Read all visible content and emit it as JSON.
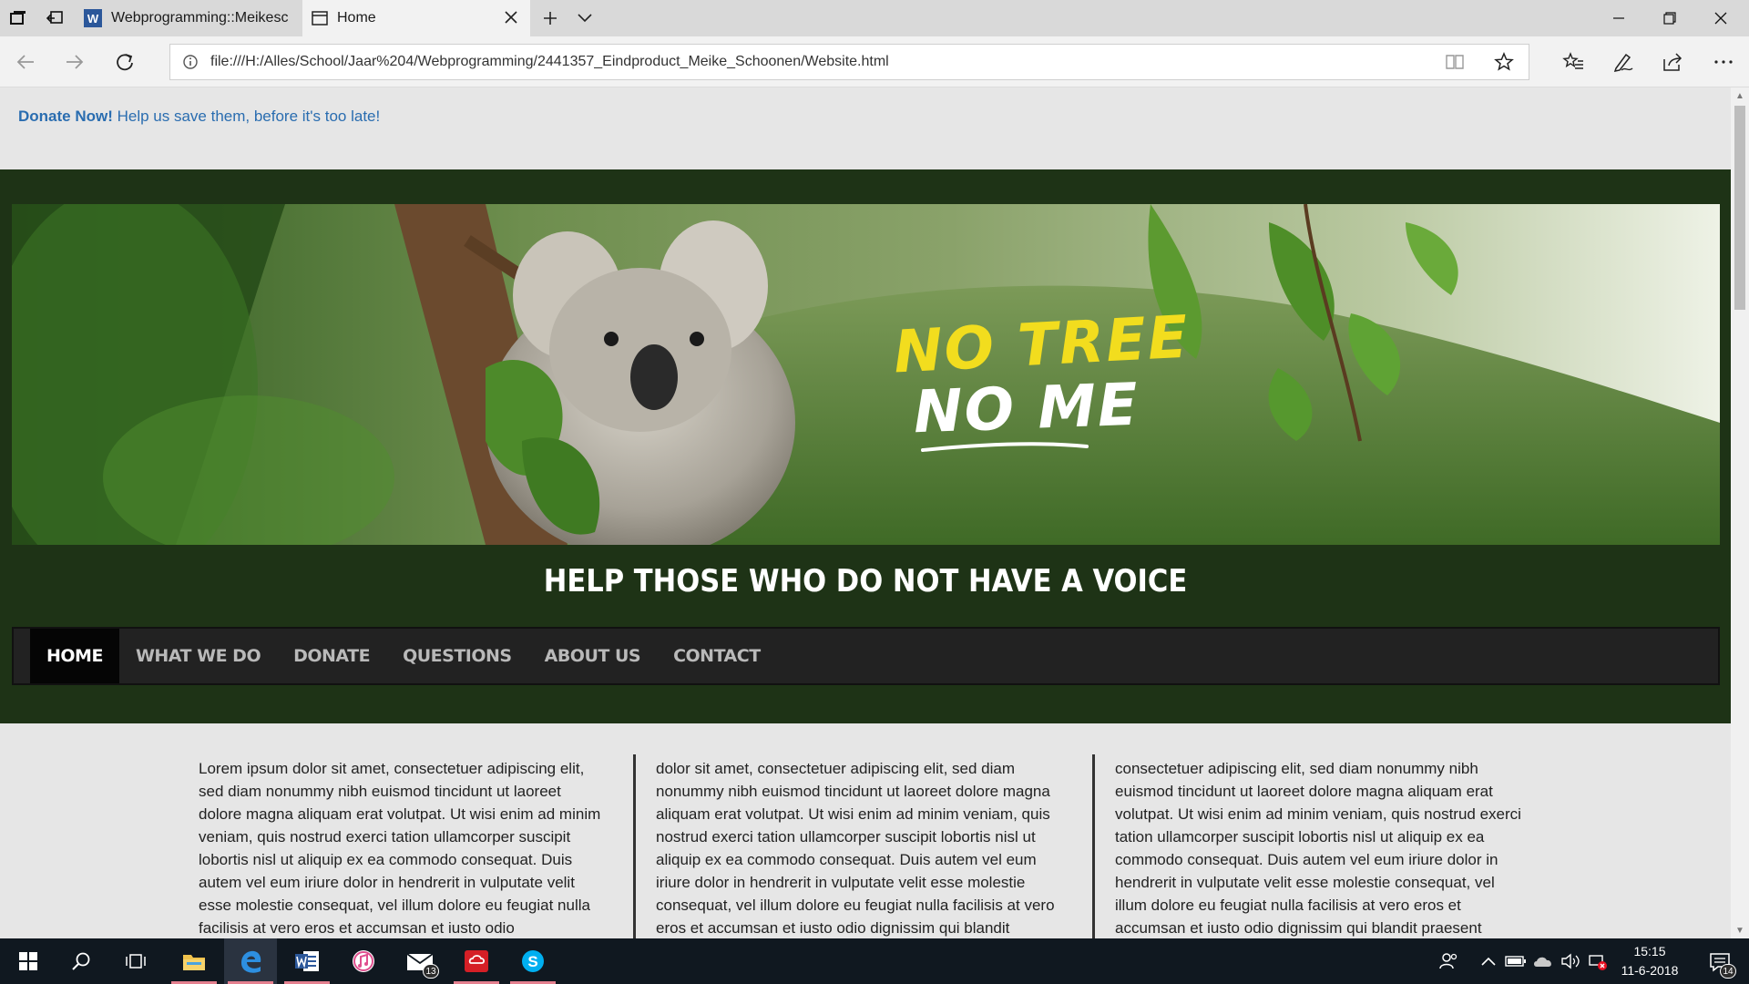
{
  "browser": {
    "tabs": [
      {
        "label": "Webprogramming::Meikesc",
        "icon": "word-icon"
      },
      {
        "label": "Home",
        "icon": "page-icon"
      }
    ],
    "address": "file:///H:/Alles/School/Jaar%204/Webprogramming/2441357_Eindproduct_Meike_Schoonen/Website.html"
  },
  "site": {
    "topbar": {
      "donate_strong": "Donate Now!",
      "donate_text": " Help us save them, before it's too late!"
    },
    "logo": {
      "line1": "NO TREE",
      "line2": "NO ME"
    },
    "tagline": "HELP THOSE WHO DO NOT HAVE A VOICE",
    "menu": [
      "HOME",
      "WHAT WE DO",
      "DONATE",
      "QUESTIONS",
      "ABOUT US",
      "CONTACT"
    ],
    "columns": [
      "Lorem ipsum dolor sit amet, consectetuer adipiscing elit, sed diam nonummy nibh euismod tincidunt ut laoreet dolore magna aliquam erat volutpat. Ut wisi enim ad minim veniam, quis nostrud exerci tation ullamcorper suscipit lobortis nisl ut aliquip ex ea commodo consequat. Duis autem vel eum iriure dolor in hendrerit in vulputate velit esse molestie consequat, vel illum dolore eu feugiat nulla facilisis at vero eros et accumsan et iusto odio",
      "dolor sit amet, consectetuer adipiscing elit, sed diam nonummy nibh euismod tincidunt ut laoreet dolore magna aliquam erat volutpat. Ut wisi enim ad minim veniam, quis nostrud exerci tation ullamcorper suscipit lobortis nisl ut aliquip ex ea commodo consequat. Duis autem vel eum iriure dolor in hendrerit in vulputate velit esse molestie consequat, vel illum dolore eu feugiat nulla facilisis at vero eros et accumsan et iusto odio dignissim qui blandit",
      "consectetuer adipiscing elit, sed diam nonummy nibh euismod tincidunt ut laoreet dolore magna aliquam erat volutpat. Ut wisi enim ad minim veniam, quis nostrud exerci tation ullamcorper suscipit lobortis nisl ut aliquip ex ea commodo consequat. Duis autem vel eum iriure dolor in hendrerit in vulputate velit esse molestie consequat, vel illum dolore eu feugiat nulla facilisis at vero eros et accumsan et iusto odio dignissim qui blandit praesent"
    ]
  },
  "taskbar": {
    "mail_badge": "13",
    "time": "15:15",
    "date": "11-6-2018",
    "notifications": "14"
  },
  "colors": {
    "header_bg": "#1e3316",
    "link": "#2a6db0",
    "logo_yellow": "#f2dd1e"
  }
}
